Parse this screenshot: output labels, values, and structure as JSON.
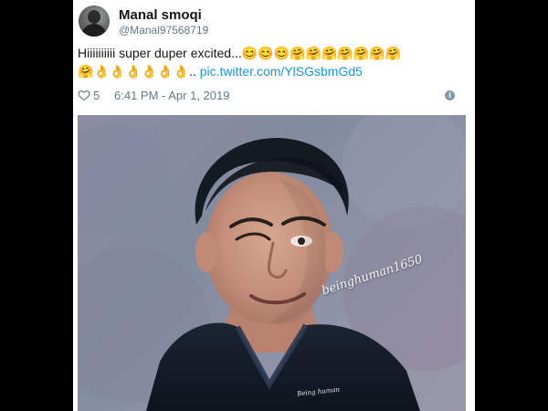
{
  "user": {
    "display_name": "Manal smoqi",
    "handle": "@Manal97568719"
  },
  "tweet": {
    "text_prefix": "Hiiiiiiiiii super duper excited...",
    "emojis_line1": [
      "😊",
      "😊",
      "😊",
      "🤗",
      "🤗",
      "🤗",
      "🤗",
      "🤗",
      "🤗",
      "🤗"
    ],
    "emojis_line2": [
      "🤗",
      "👌",
      "👌",
      "👌",
      "👌",
      "👌",
      "👌"
    ],
    "ellipsis": "..",
    "link_text": "pic.twitter.com/YlSGsbmGd5"
  },
  "meta": {
    "like_count": "5",
    "timestamp": "6:41 PM - Apr 1, 2019",
    "heart_icon": "heart-outline",
    "info_icon": "info-circle"
  },
  "media": {
    "watermark": "beinghuman1650",
    "shirt_logo": "Being human"
  }
}
